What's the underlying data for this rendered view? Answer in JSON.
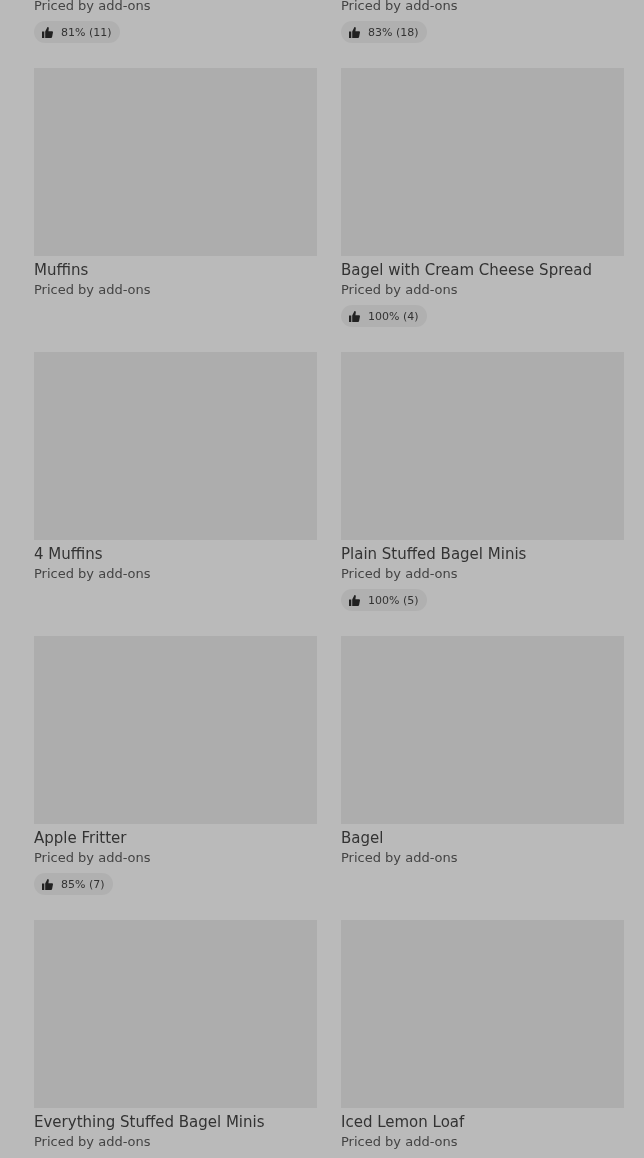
{
  "items": [
    {
      "price": "Priced by add-ons",
      "rating": "81% (11)"
    },
    {
      "price": "Priced by add-ons",
      "rating": "83% (18)"
    },
    {
      "name": "Muffins",
      "price": "Priced by add-ons"
    },
    {
      "name": "Bagel with Cream Cheese Spread",
      "price": "Priced by add-ons",
      "rating": "100% (4)"
    },
    {
      "name": "4 Muffins",
      "price": "Priced by add-ons"
    },
    {
      "name": "Plain Stuffed Bagel Minis",
      "price": "Priced by add-ons",
      "rating": "100% (5)"
    },
    {
      "name": "Apple Fritter",
      "price": "Priced by add-ons",
      "rating": "85% (7)"
    },
    {
      "name": "Bagel",
      "price": "Priced by add-ons"
    },
    {
      "name": "Everything Stuffed Bagel Minis",
      "price": "Priced by add-ons"
    },
    {
      "name": "Iced Lemon Loaf",
      "price": "Priced by add-ons"
    }
  ]
}
